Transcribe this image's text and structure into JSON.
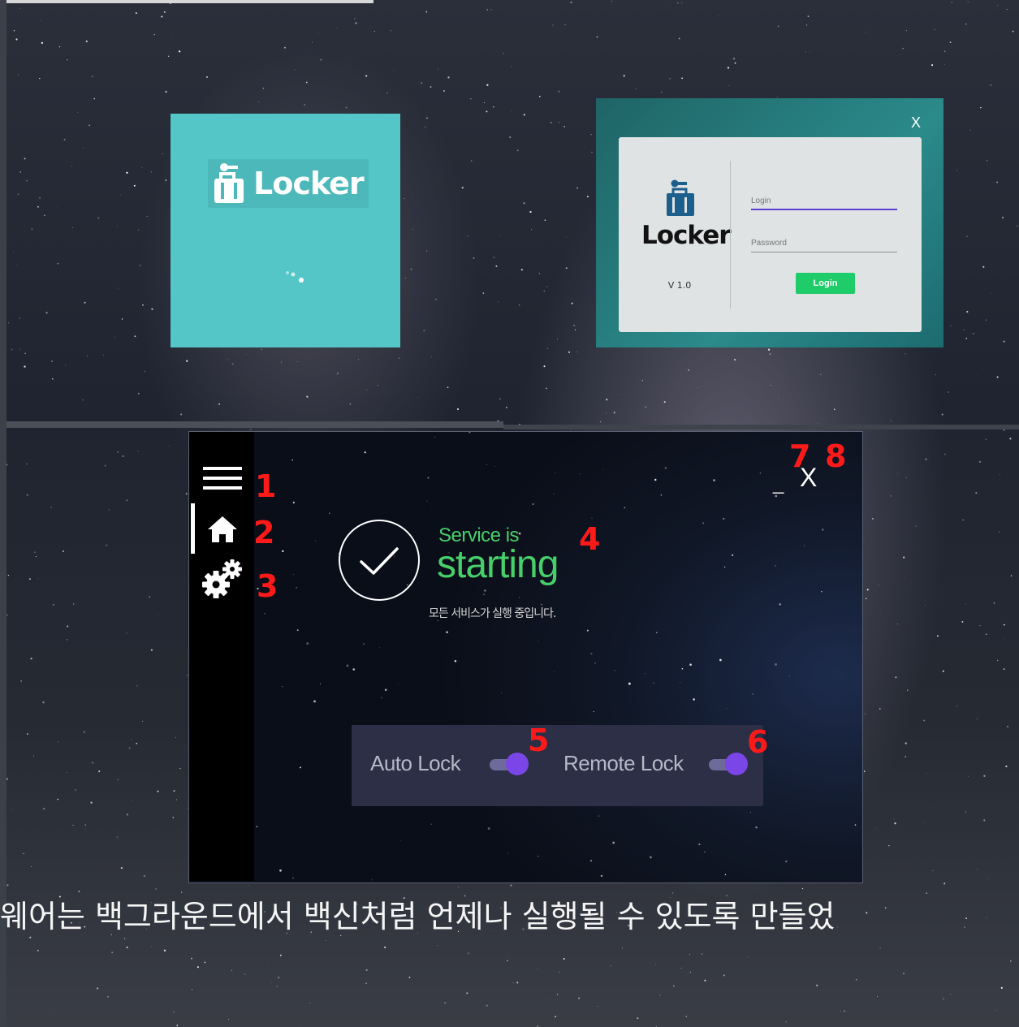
{
  "splash": {
    "logo_text": "Locker"
  },
  "login_dialog": {
    "close_label": "X",
    "brand": "Locker",
    "version": "V 1.0",
    "login_placeholder": "Login",
    "password_placeholder": "Password",
    "login_button": "Login",
    "accent_color": "#5b3fd0",
    "button_color": "#1fcc6a"
  },
  "main_window": {
    "menu_icon": "hamburger-icon",
    "nav": [
      {
        "icon": "home-icon",
        "active": true
      },
      {
        "icon": "gears-icon",
        "active": false
      }
    ],
    "status": {
      "line1": "Service is",
      "line2": "starting",
      "subtitle": "모든 서비스가 실행 중입니다.",
      "icon": "check-circle-icon",
      "color": "#47d06a"
    },
    "minimize_label": "_",
    "close_label": "X",
    "toggles": [
      {
        "label": "Auto Lock",
        "on": true
      },
      {
        "label": "Remote Lock",
        "on": true
      }
    ],
    "toggle_color": "#7a46e8"
  },
  "annotations": [
    "1",
    "2",
    "3",
    "4",
    "5",
    "6",
    "7",
    "8"
  ],
  "caption": "웨어는 백그라운드에서 백신처럼 언제나 실행될 수 있도록 만들었"
}
